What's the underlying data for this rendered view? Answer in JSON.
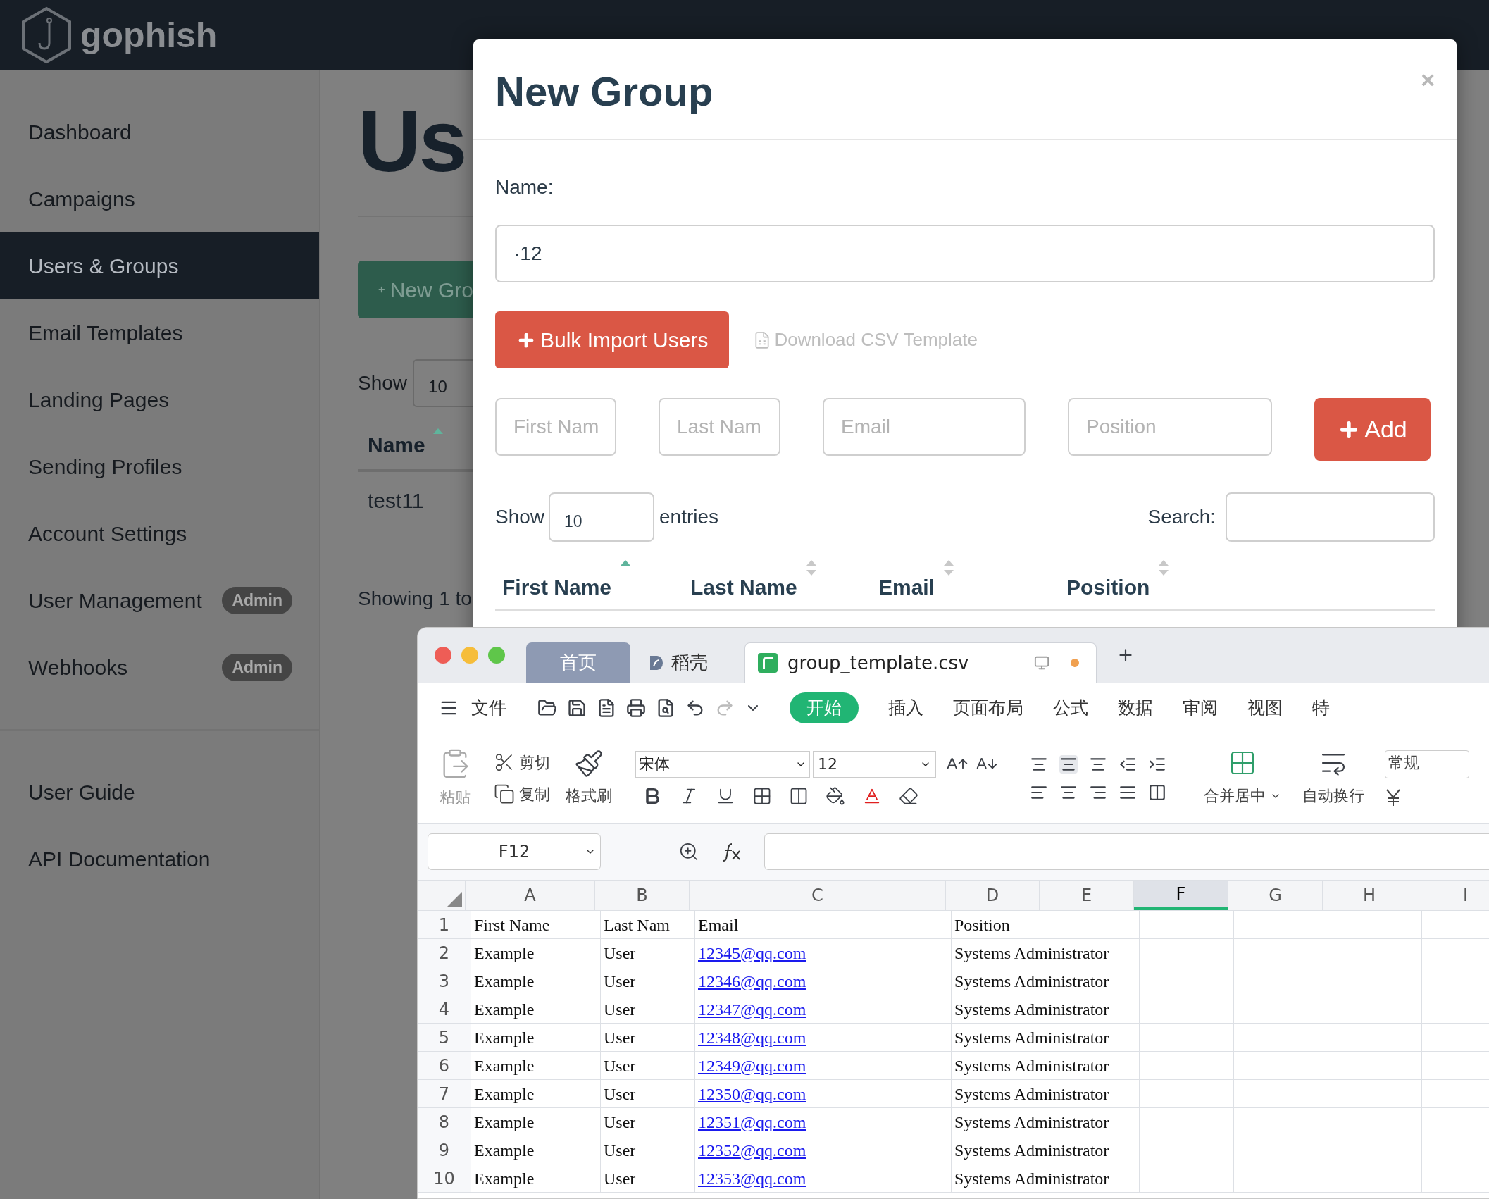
{
  "header": {
    "logo": "gophish"
  },
  "sidebar": {
    "items": [
      {
        "label": "Dashboard",
        "selected": false
      },
      {
        "label": "Campaigns",
        "selected": false
      },
      {
        "label": "Users & Groups",
        "selected": true
      },
      {
        "label": "Email Templates",
        "selected": false
      },
      {
        "label": "Landing Pages",
        "selected": false
      },
      {
        "label": "Sending Profiles",
        "selected": false
      },
      {
        "label": "Account Settings",
        "selected": false
      },
      {
        "label": "User Management",
        "selected": false,
        "badge": "Admin"
      },
      {
        "label": "Webhooks",
        "selected": false,
        "badge": "Admin"
      }
    ],
    "links": [
      {
        "label": "User Guide"
      },
      {
        "label": "API Documentation"
      }
    ]
  },
  "page": {
    "title": "Us",
    "new_button": "New Gro",
    "show_label": "Show",
    "show_value": "10",
    "column": {
      "label": "Name",
      "sorted": true
    },
    "rows": [
      "test11"
    ],
    "footer": "Showing 1 to"
  },
  "modal": {
    "title": "New Group",
    "close": "×",
    "name_label": "Name:",
    "name_value": "·12",
    "bulk_button": "Bulk Import Users",
    "download_link": "Download CSV Template",
    "fields": [
      {
        "placeholder": "First Nam"
      },
      {
        "placeholder": "Last Nam"
      },
      {
        "placeholder": "Email"
      },
      {
        "placeholder": "Position"
      }
    ],
    "add_button": "Add",
    "show_label": "Show",
    "show_value": "10",
    "entries_label": "entries",
    "search_label": "Search:",
    "columns": [
      {
        "label": "First Name",
        "sorted": true
      },
      {
        "label": "Last Name",
        "sorted": false
      },
      {
        "label": "Email",
        "sorted": false
      },
      {
        "label": "Position",
        "sorted": false
      }
    ]
  },
  "spreadsheet": {
    "tabs": [
      {
        "label": "首页",
        "kind": "home",
        "selected": false
      },
      {
        "label": "稻壳",
        "kind": "docer",
        "selected": false
      },
      {
        "label": "group_template.csv",
        "kind": "file",
        "selected": true
      }
    ],
    "menu": "文件",
    "ribbon_tabs": [
      {
        "label": "开始",
        "selected": true
      },
      {
        "label": "插入",
        "selected": false
      },
      {
        "label": "页面布局",
        "selected": false
      },
      {
        "label": "公式",
        "selected": false
      },
      {
        "label": "数据",
        "selected": false
      },
      {
        "label": "审阅",
        "selected": false
      },
      {
        "label": "视图",
        "selected": false
      },
      {
        "label": "特",
        "selected": false
      }
    ],
    "ribbon": {
      "paste": "粘贴",
      "cut": "剪切",
      "copy": "复制",
      "format_painter": "格式刷",
      "font": "宋体",
      "font_size": "12",
      "merge": "合并居中",
      "wrap": "自动换行",
      "number_format": "常规"
    },
    "name_box": "F12",
    "columns": [
      {
        "label": "A",
        "selected": false
      },
      {
        "label": "B",
        "selected": false
      },
      {
        "label": "C",
        "selected": false
      },
      {
        "label": "D",
        "selected": false
      },
      {
        "label": "E",
        "selected": false
      },
      {
        "label": "F",
        "selected": true
      },
      {
        "label": "G",
        "selected": false
      },
      {
        "label": "H",
        "selected": false
      },
      {
        "label": "I",
        "selected": false
      }
    ],
    "rows": [
      {
        "number": "1",
        "cells": [
          {
            "text": "First Name"
          },
          {
            "text": "Last Nam"
          },
          {
            "text": "Email"
          },
          {
            "text": "Position"
          }
        ]
      },
      {
        "number": "2",
        "cells": [
          {
            "text": "Example"
          },
          {
            "text": "User"
          },
          {
            "text": "12345@qq.com",
            "link": true
          },
          {
            "text": "Systems Administrator"
          }
        ]
      },
      {
        "number": "3",
        "cells": [
          {
            "text": "Example"
          },
          {
            "text": "User"
          },
          {
            "text": "12346@qq.com",
            "link": true
          },
          {
            "text": "Systems Administrator"
          }
        ]
      },
      {
        "number": "4",
        "cells": [
          {
            "text": "Example"
          },
          {
            "text": "User"
          },
          {
            "text": "12347@qq.com",
            "link": true
          },
          {
            "text": "Systems Administrator"
          }
        ]
      },
      {
        "number": "5",
        "cells": [
          {
            "text": "Example"
          },
          {
            "text": "User"
          },
          {
            "text": "12348@qq.com",
            "link": true
          },
          {
            "text": "Systems Administrator"
          }
        ]
      },
      {
        "number": "6",
        "cells": [
          {
            "text": "Example"
          },
          {
            "text": "User"
          },
          {
            "text": "12349@qq.com",
            "link": true
          },
          {
            "text": "Systems Administrator"
          }
        ]
      },
      {
        "number": "7",
        "cells": [
          {
            "text": "Example"
          },
          {
            "text": "User"
          },
          {
            "text": "12350@qq.com",
            "link": true
          },
          {
            "text": "Systems Administrator"
          }
        ]
      },
      {
        "number": "8",
        "cells": [
          {
            "text": "Example"
          },
          {
            "text": "User"
          },
          {
            "text": "12351@qq.com",
            "link": true
          },
          {
            "text": "Systems Administrator"
          }
        ]
      },
      {
        "number": "9",
        "cells": [
          {
            "text": "Example"
          },
          {
            "text": "User"
          },
          {
            "text": "12352@qq.com",
            "link": true
          },
          {
            "text": "Systems Administrator"
          }
        ]
      },
      {
        "number": "10",
        "cells": [
          {
            "text": "Example"
          },
          {
            "text": "User"
          },
          {
            "text": "12353@qq.com",
            "link": true
          },
          {
            "text": "Systems Administrator"
          }
        ]
      }
    ]
  }
}
